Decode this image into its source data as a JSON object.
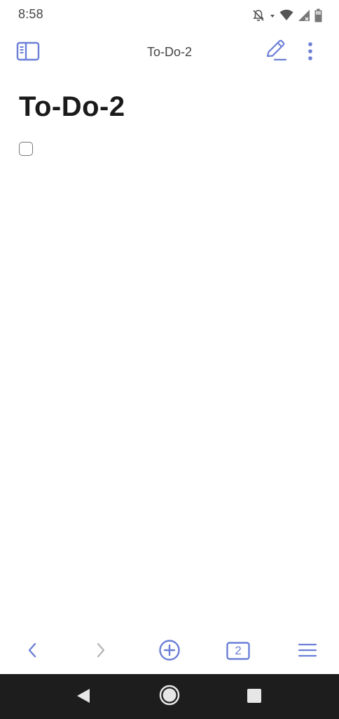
{
  "status_bar": {
    "time": "8:58",
    "icons": [
      "bell-off-icon",
      "wifi-icon",
      "signal-icon",
      "battery-icon"
    ]
  },
  "app_bar": {
    "title": "To-Do-2",
    "icons": [
      "sidebar-toggle-icon",
      "pencil-edit-icon",
      "more-vertical-icon"
    ]
  },
  "note": {
    "title": "To-Do-2",
    "items": [
      {
        "checked": false,
        "text": ""
      }
    ]
  },
  "bottom_toolbar": {
    "tab_count": "2",
    "icons": [
      "chevron-left-icon",
      "chevron-right-icon",
      "plus-circle-icon",
      "tabs-icon",
      "hamburger-menu-icon"
    ],
    "forward_enabled": false
  },
  "nav_bar": {
    "icons": [
      "back-triangle-icon",
      "home-circle-icon",
      "recents-square-icon"
    ]
  },
  "colors": {
    "accent": "#6b7fd7",
    "disabled": "#b3b3b3",
    "text_primary": "#1a1a1a",
    "text_secondary": "#444444",
    "nav_bar_bg": "#1d1d1d"
  }
}
